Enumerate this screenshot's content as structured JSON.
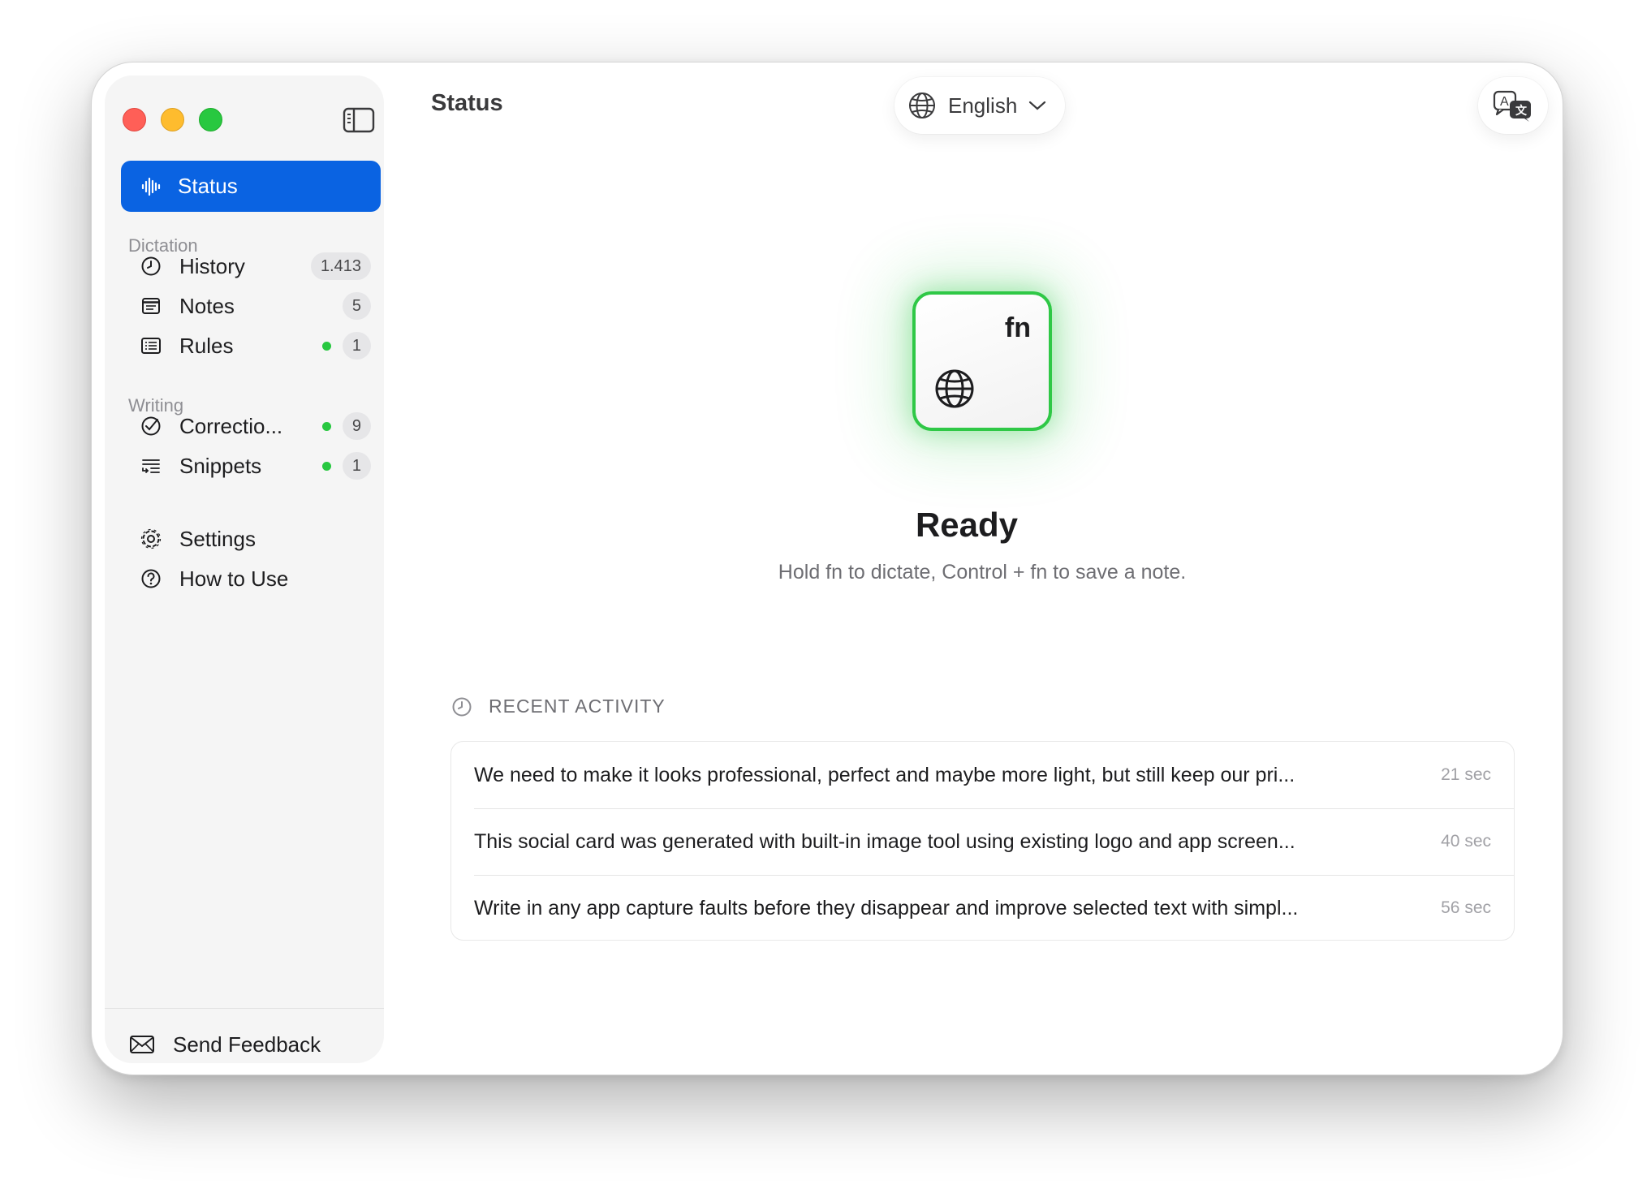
{
  "window": {
    "title": "Status"
  },
  "sidebar": {
    "active": {
      "label": "Status",
      "icon": "waveform-icon"
    },
    "sections": [
      {
        "label": "Dictation",
        "items": [
          {
            "label": "History",
            "icon": "clock-icon",
            "badge": "1.413",
            "dot": false
          },
          {
            "label": "Notes",
            "icon": "note-icon",
            "badge": "5",
            "dot": false
          },
          {
            "label": "Rules",
            "icon": "list-icon",
            "badge": "1",
            "dot": true
          }
        ]
      },
      {
        "label": "Writing",
        "items": [
          {
            "label": "Correctio...",
            "icon": "correction-icon",
            "badge": "9",
            "dot": true
          },
          {
            "label": "Snippets",
            "icon": "snippets-icon",
            "badge": "1",
            "dot": true
          }
        ]
      }
    ],
    "footer_items": [
      {
        "label": "Settings",
        "icon": "gear-icon"
      },
      {
        "label": "How to Use",
        "icon": "question-icon"
      }
    ],
    "feedback": {
      "label": "Send Feedback",
      "icon": "envelope-icon"
    }
  },
  "header": {
    "title": "Status",
    "language": "English"
  },
  "key": {
    "label": "fn"
  },
  "status": {
    "title": "Ready",
    "subtitle": "Hold fn to dictate, Control + fn to save a note."
  },
  "recent": {
    "header": "RECENT ACTIVITY",
    "items": [
      {
        "text": "We need to make it looks professional, perfect and maybe more light, but still keep our pri...",
        "time": "21 sec"
      },
      {
        "text": "This social card was generated with built-in image tool using existing logo and app screen...",
        "time": "40 sec"
      },
      {
        "text": "Write in any app capture faults before they disappear and improve selected text with simpl...",
        "time": "56 sec"
      }
    ]
  },
  "colors": {
    "accent": "#0a63e2",
    "status_green": "#28c840",
    "traffic_red": "#ff5f57",
    "traffic_yellow": "#febc2e",
    "traffic_green": "#28c840"
  }
}
